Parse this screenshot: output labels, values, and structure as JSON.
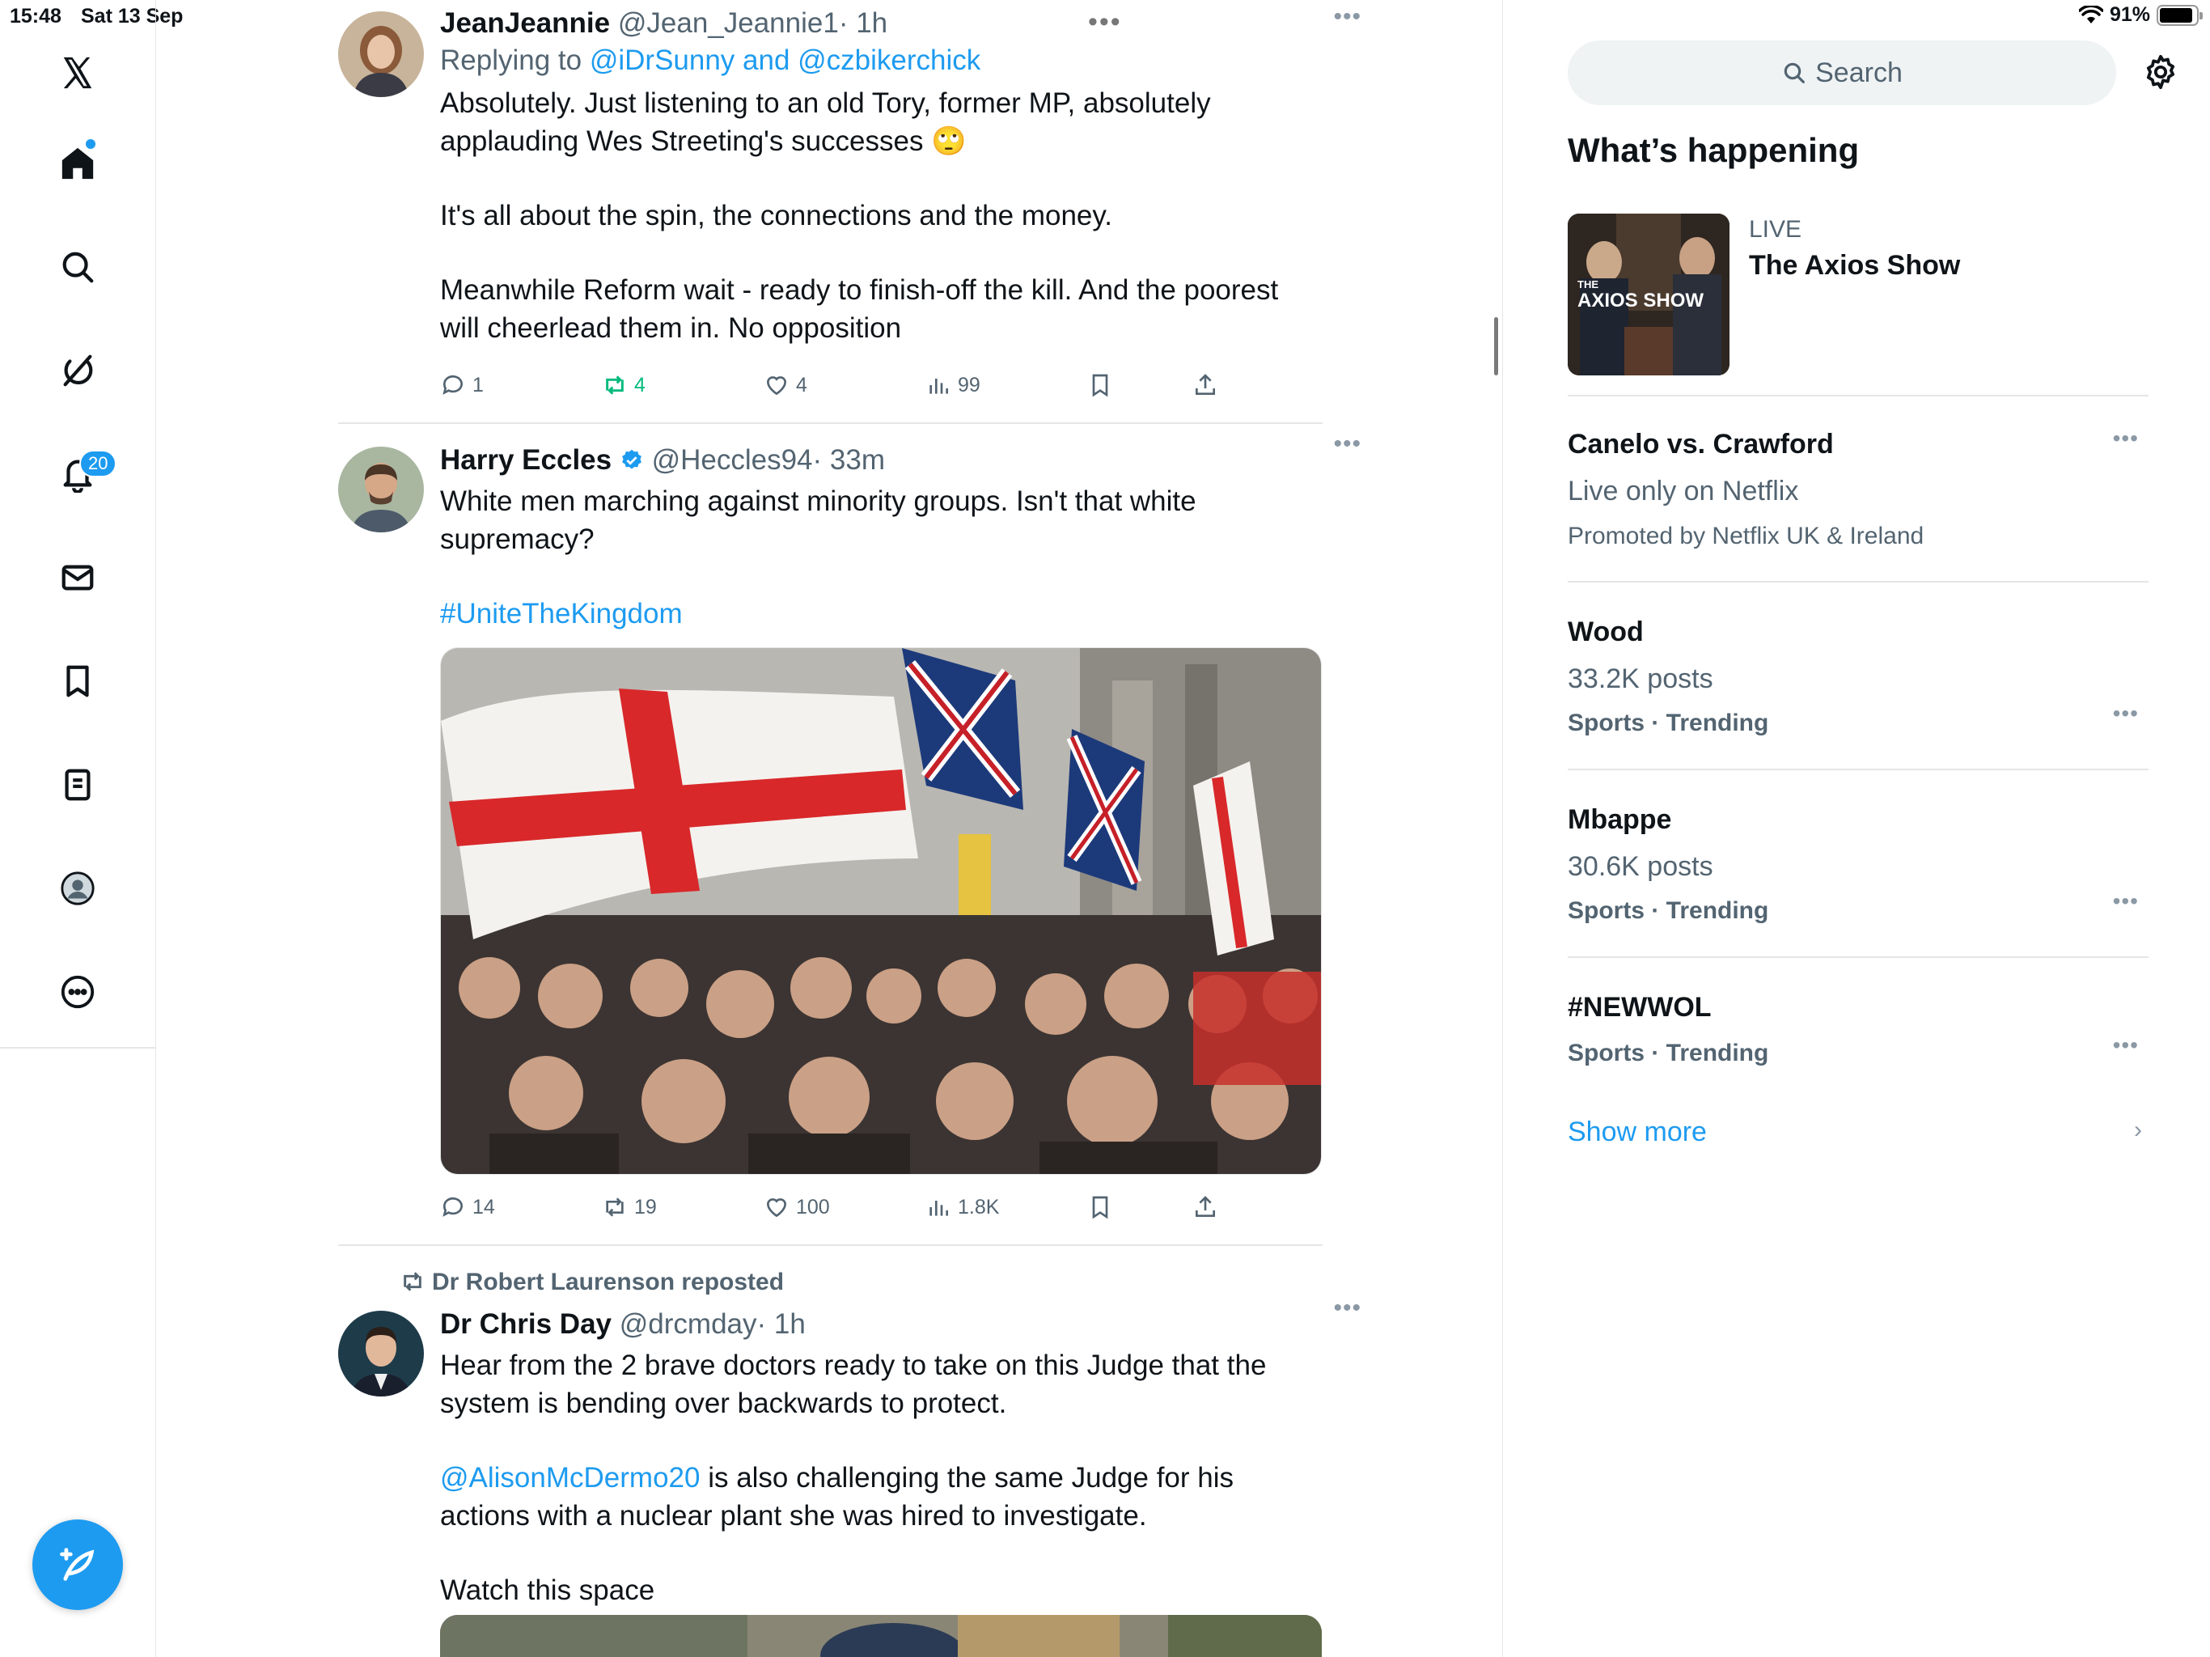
{
  "status_bar": {
    "time": "15:48",
    "date": "Sat 13 Sep",
    "battery": "91%",
    "battery_level": 0.91
  },
  "nav": {
    "notifications_badge": "20",
    "icons": [
      "x-logo-icon",
      "home-icon",
      "search-icon",
      "grok-icon",
      "notifications-icon",
      "messages-icon",
      "bookmarks-icon",
      "lists-icon",
      "profile-icon",
      "more-icon"
    ]
  },
  "tweets": [
    {
      "name": "JeanJeannie",
      "handle": "@Jean_Jeannie1",
      "time": "· 1h",
      "replying_prefix": "Replying to ",
      "replying_to": "@iDrSunny and @czbikerchick",
      "paragraphs": [
        "Absolutely. Just listening to an old Tory, former MP, absolutely applauding Wes Streeting's successes 🙄",
        "It's all about the spin, the connections and the money.",
        "Meanwhile Reform wait - ready to finish-off the kill. And the poorest will cheerlead them in. No opposition"
      ],
      "replies": "1",
      "reposts": "4",
      "likes": "4",
      "views": "99"
    },
    {
      "name": "Harry Eccles",
      "handle": "@Heccles94",
      "time": "· 33m",
      "paragraphs": [
        "White men marching against minority groups. Isn't that white supremacy?"
      ],
      "hashtag": "#UniteTheKingdom",
      "replies": "14",
      "reposts": "19",
      "likes": "100",
      "views": "1.8K"
    },
    {
      "reposted_by": "Dr Robert Laurenson reposted",
      "name": "Dr Chris Day",
      "handle": "@drcmday",
      "time": "· 1h",
      "paragraphs": [
        "Hear from the 2 brave doctors ready to take on this Judge that the system is bending over backwards to protect."
      ],
      "mention": "@AlisonMcDermo20",
      "mention_rest": " is also challenging the same Judge for his actions with a nuclear plant she was hired to investigate.",
      "closing": "Watch this space"
    }
  ],
  "right": {
    "search_placeholder": "Search",
    "section_title": "What’s happening",
    "live": {
      "label": "LIVE",
      "title": "The Axios Show",
      "thumb_text": "AXIOS SHOW",
      "thumb_small": "THE"
    },
    "trends": [
      {
        "title": "Canelo vs. Crawford",
        "sub": "Live only on Netflix",
        "meta": "Promoted by Netflix UK & Ireland"
      },
      {
        "title": "Wood",
        "sub": "33.2K posts",
        "meta": "Sports · Trending"
      },
      {
        "title": "Mbappe",
        "sub": "30.6K posts",
        "meta": "Sports · Trending"
      },
      {
        "title": "#NEWWOL",
        "meta": "Sports · Trending"
      }
    ],
    "show_more": "Show more"
  }
}
